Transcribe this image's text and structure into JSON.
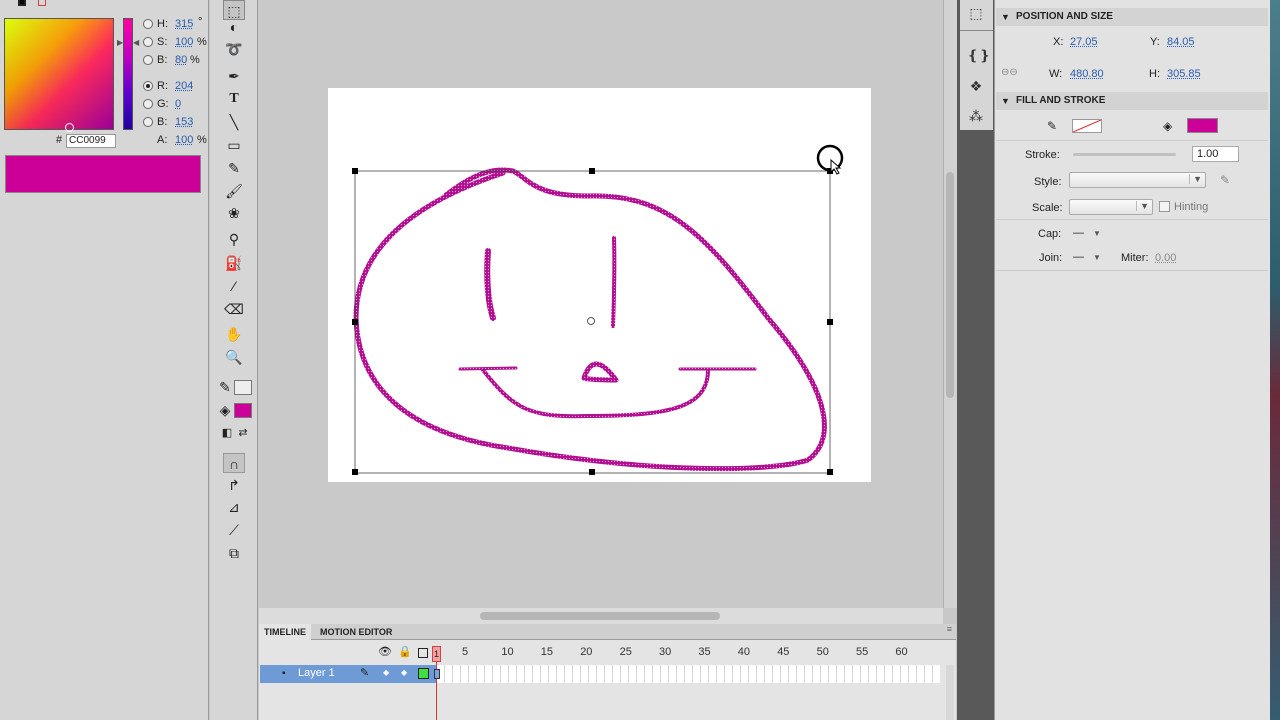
{
  "color_panel": {
    "h_label": "H:",
    "h_value": "315",
    "h_unit": "°",
    "s_label": "S:",
    "s_value": "100",
    "s_unit": "%",
    "b1_label": "B:",
    "b1_value": "80",
    "b1_unit": "%",
    "r_label": "R:",
    "r_value": "204",
    "g_label": "G:",
    "g_value": "0",
    "b2_label": "B:",
    "b2_value": "153",
    "a_label": "A:",
    "a_value": "100",
    "a_unit": "%",
    "hex_prefix": "#",
    "hex_value": "CC0099",
    "current_color": "#cc0099"
  },
  "timeline": {
    "tab_timeline": "TIMELINE",
    "tab_motion": "MOTION EDITOR",
    "layer_name": "Layer 1",
    "playhead": "1",
    "frame_numbers": [
      "5",
      "10",
      "15",
      "20",
      "25",
      "30",
      "35",
      "40",
      "45",
      "50",
      "55",
      "60"
    ]
  },
  "properties": {
    "pos_size_title": "POSITION AND SIZE",
    "x_label": "X:",
    "x_value": "27.05",
    "y_label": "Y:",
    "y_value": "84.05",
    "w_label": "W:",
    "w_value": "480.80",
    "h_label": "H:",
    "h_value": "305.85",
    "fill_stroke_title": "FILL AND STROKE",
    "fill_color": "#cc0099",
    "stroke_label": "Stroke:",
    "stroke_value": "1.00",
    "style_label": "Style:",
    "scale_label": "Scale:",
    "hinting_label": "Hinting",
    "cap_label": "Cap:",
    "cap_value": "—",
    "join_label": "Join:",
    "join_value": "—",
    "miter_label": "Miter:",
    "miter_value": "0.00"
  },
  "drawing": {
    "stroke_color": "#b0108f"
  }
}
